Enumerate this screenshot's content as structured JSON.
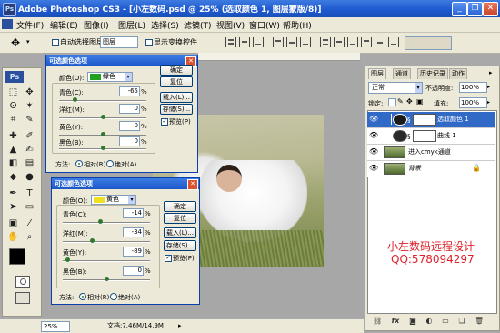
{
  "window": {
    "title": "Adobe Photoshop CS3 - [小左数码.psd @ 25% (选取颜色 1, 图层蒙版/8)]",
    "app_icon": "Ps",
    "controls": [
      "minimize-icon",
      "restore-icon",
      "close-icon"
    ]
  },
  "menu": [
    "文件(F)",
    "编辑(E)",
    "图像(I)",
    "图层(L)",
    "选择(S)",
    "滤镜(T)",
    "视图(V)",
    "窗口(W)",
    "帮助(H)"
  ],
  "options_bar": {
    "tool_icon": "move-icon",
    "auto_select_label": "自动选择图层",
    "auto_select_value": "图层",
    "show_transform_label": "显示变换控件"
  },
  "toolbox": {
    "logo": "Ps",
    "tools": [
      "move-icon",
      "marquee-icon",
      "lasso-icon",
      "magic-wand-icon",
      "crop-icon",
      "slice-icon",
      "healing-icon",
      "brush-icon",
      "stamp-icon",
      "history-brush-icon",
      "eraser-icon",
      "gradient-icon",
      "blur-icon",
      "dodge-icon",
      "pen-icon",
      "type-icon",
      "path-select-icon",
      "shape-icon",
      "notes-icon",
      "eyedropper-icon",
      "hand-icon",
      "zoom-icon"
    ]
  },
  "dialog1": {
    "title": "可选颜色选项",
    "color_label": "颜色(O):",
    "color_value": "绿色",
    "color_swatch": "#1fa01f",
    "rows": [
      {
        "label": "青色(C):",
        "value": "-65",
        "unit": "%",
        "level": -0.65
      },
      {
        "label": "洋红(M):",
        "value": "0",
        "unit": "%",
        "level": 0
      },
      {
        "label": "黄色(Y):",
        "value": "0",
        "unit": "%",
        "level": 0
      },
      {
        "label": "黑色(B):",
        "value": "0",
        "unit": "%",
        "level": 0
      }
    ],
    "buttons": {
      "ok": "确定",
      "reset": "复位",
      "load": "载入(L)...",
      "save": "存储(S)..."
    },
    "preview_label": "预览(P)",
    "method_label": "方法:",
    "method_relative": "相对(R)",
    "method_absolute": "绝对(A)"
  },
  "dialog2": {
    "title": "可选颜色选项",
    "color_label": "颜色(O):",
    "color_value": "黄色",
    "color_swatch": "#f0e020",
    "rows": [
      {
        "label": "青色(C):",
        "value": "-14",
        "unit": "%",
        "level": -0.14
      },
      {
        "label": "洋红(M):",
        "value": "-34",
        "unit": "%",
        "level": -0.34
      },
      {
        "label": "黄色(Y):",
        "value": "-89",
        "unit": "%",
        "level": -0.89
      },
      {
        "label": "黑色(B):",
        "value": "0",
        "unit": "%",
        "level": 0
      }
    ],
    "buttons": {
      "ok": "确定",
      "reset": "复位",
      "load": "载入(L)...",
      "save": "存储(S)..."
    },
    "preview_label": "预览(P)",
    "method_label": "方法:",
    "method_relative": "相对(R)",
    "method_absolute": "绝对(A)"
  },
  "status": {
    "zoom": "25%",
    "doc": "文档:7.46M/14.9M"
  },
  "layers_panel": {
    "tabs": [
      "图层",
      "通道",
      "历史记录",
      "动作"
    ],
    "blend_mode": "正常",
    "opacity_label": "不透明度:",
    "opacity_value": "100%",
    "lock_label": "锁定:",
    "fill_label": "填充:",
    "fill_value": "100%",
    "layers": [
      {
        "name": "选取颜色 1",
        "selected": true,
        "type": "adjustment"
      },
      {
        "name": "曲线 1",
        "selected": false,
        "type": "adjustment"
      },
      {
        "name": "进入cmyk通道",
        "selected": false,
        "type": "image"
      },
      {
        "name": "背景",
        "selected": false,
        "type": "image",
        "locked": true
      }
    ],
    "bottom_icons": [
      "link-icon",
      "fx-icon",
      "mask-icon",
      "adjustment-icon",
      "group-icon",
      "new-layer-icon",
      "trash-icon"
    ]
  },
  "watermark": {
    "line1": "小左数码远程设计",
    "line2": "QQ:578094297",
    "color": "#e0212b"
  }
}
